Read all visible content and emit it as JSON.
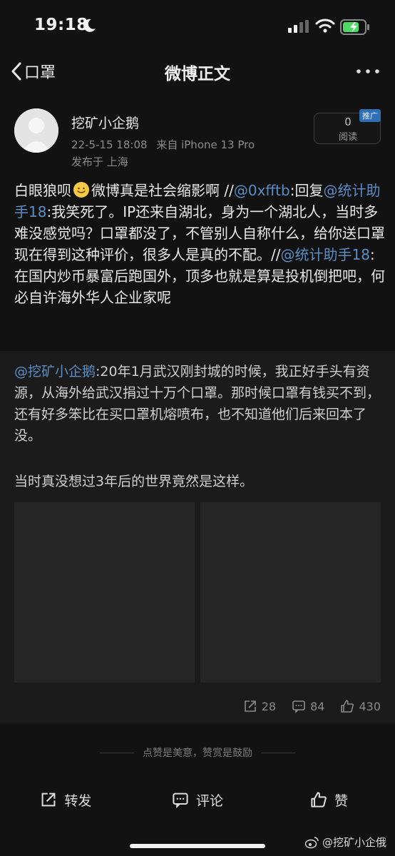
{
  "status_bar": {
    "time": "19:18"
  },
  "nav": {
    "back_label": "口罩",
    "title": "微博正文"
  },
  "author": {
    "name": "挖矿小企鹅",
    "date": "22-5-15 18:08",
    "source": "来自 iPhone 13 Pro",
    "location": "发布于 上海",
    "read_count": "0",
    "read_label": "阅读",
    "promo_tag": "推广"
  },
  "post": {
    "t1": "白眼狼呗",
    "t2": "微博真是社会缩影啊 //",
    "m1": "@0xfftb",
    "t3": ":回复",
    "m2": "@统计助手18",
    "t4": ":我笑死了。IP还来自湖北，身为一个湖北人，当时多难没感觉吗？口罩都没了，不管别人自称什么，给你送口罩现在得到这种评价，很多人是真的不配。//",
    "m3": "@统计助手18",
    "t5": ":在国内炒币暴富后跑国外，顶多也就是算是投机倒把吧，何必自许海外华人企业家呢"
  },
  "retweet": {
    "mention": "@挖矿小企鹅",
    "text1": ":20年1月武汉刚封城的时候，我正好手头有资源，从海外给武汉捐过十万个口罩。那时候口罩有钱买不到，还有好多笨比在买口罩机熔喷布，也不知道他们后来回本了没。",
    "text2": "当时真没想过3年后的世界竟然是这样。",
    "reposts": "28",
    "comments": "84",
    "likes": "430"
  },
  "reward_text": "点赞是美意，赞赏是鼓励",
  "actions": {
    "repost": "转发",
    "comment": "评论",
    "like": "赞"
  },
  "watermark": "@挖矿小企俄",
  "icons": [
    "moon-icon",
    "signal-icon",
    "wifi-icon",
    "battery-icon",
    "back-chevron-icon",
    "more-icon",
    "avatar-icon",
    "smile-emoji-icon",
    "repost-icon",
    "comment-icon",
    "like-icon",
    "weibo-logo-icon"
  ]
}
